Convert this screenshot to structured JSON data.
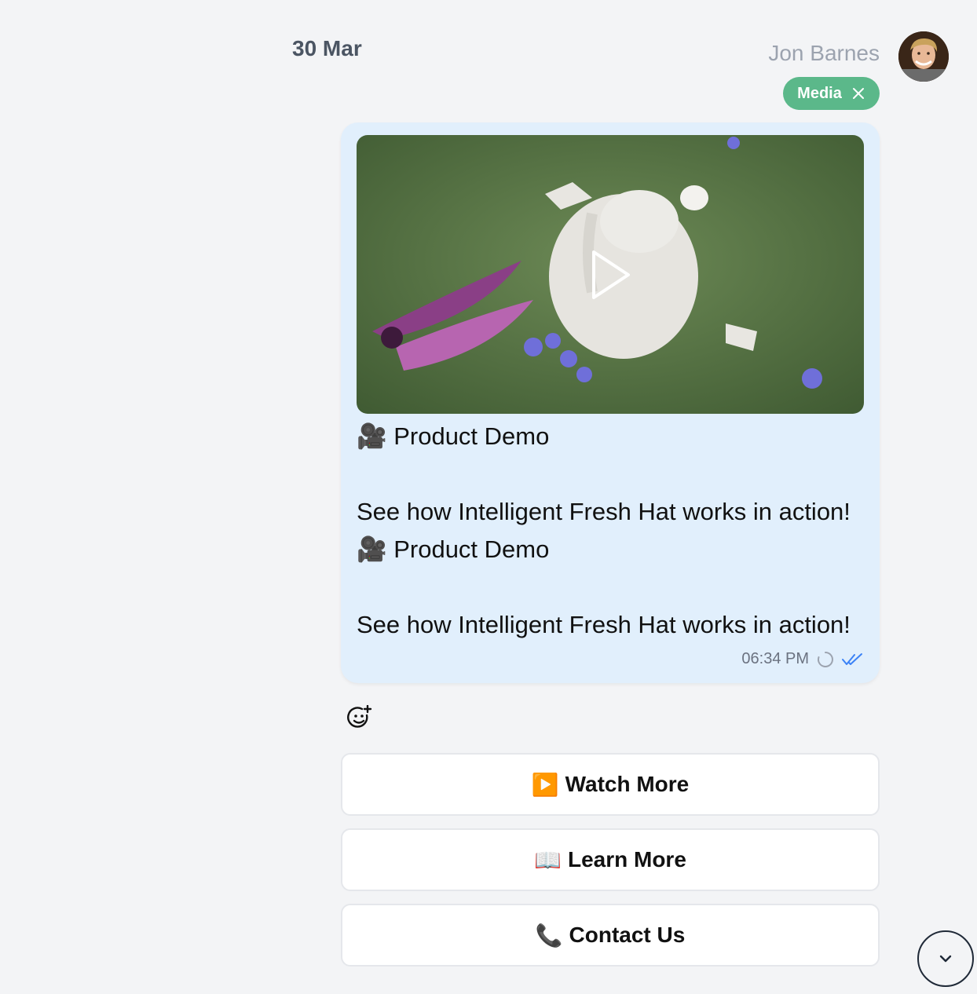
{
  "date_separator": "30 Mar",
  "sender": {
    "name": "Jon Barnes",
    "avatar_icon": "avatar"
  },
  "badge": {
    "label": "Media",
    "icon": "close-icon",
    "color": "#5bb88a"
  },
  "message": {
    "video_icon": "play-icon",
    "text": "🎥 Product Demo\n\nSee how Intelligent Fresh Hat works in action!\n🎥 Product Demo\n\nSee how Intelligent Fresh Hat works in action!",
    "time": "06:34 PM",
    "status_icons": [
      "loading-spinner-icon",
      "double-check-icon"
    ],
    "bubble_color": "#e1effc"
  },
  "reaction_icon": "add-reaction-icon",
  "buttons": [
    {
      "icon": "▶️",
      "label": "Watch More"
    },
    {
      "icon": "📖",
      "label": "Learn More"
    },
    {
      "icon": "📞",
      "label": "Contact Us"
    }
  ],
  "scroll_icon": "chevron-down-icon"
}
